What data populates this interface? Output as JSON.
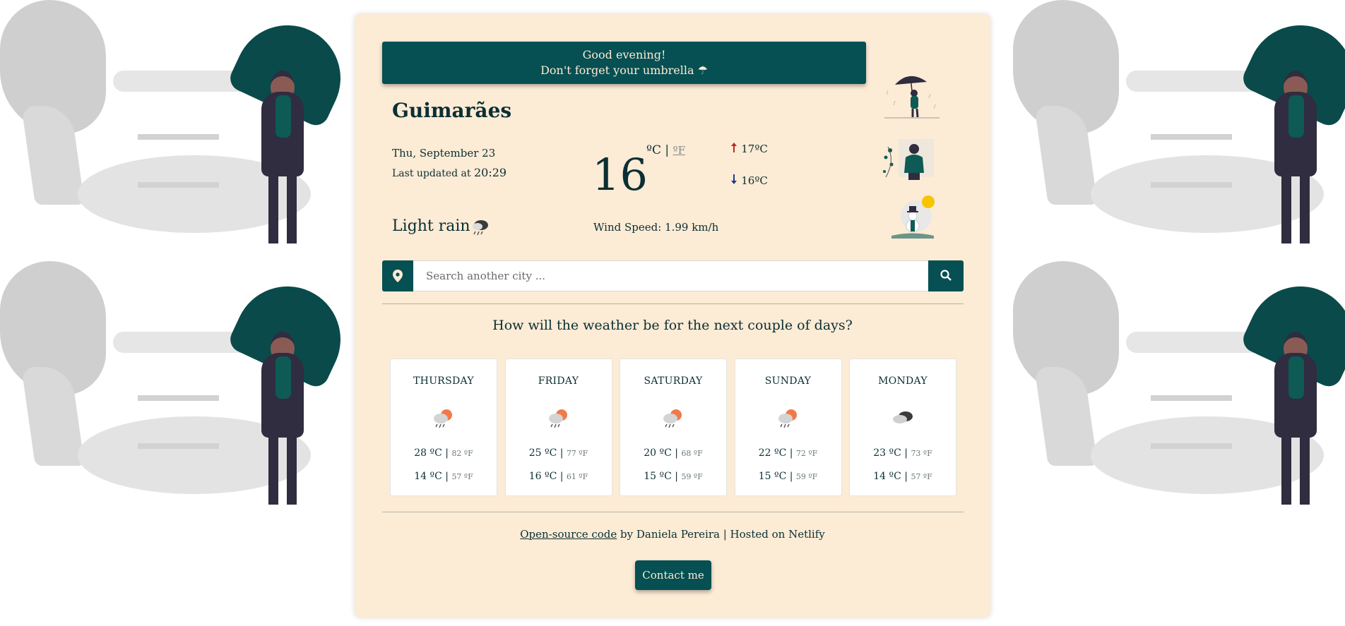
{
  "greeting": {
    "line1": "Good evening!",
    "line2": "Don't forget your umbrella ☂"
  },
  "current": {
    "city": "Guimarães",
    "date": "Thu, September 23",
    "updated_label": "Last updated at",
    "updated_time": "20:29",
    "temperature": "16",
    "unit_c": "ºC",
    "unit_sep": "|",
    "unit_f": "ºF",
    "max_arrow": "🠕",
    "max": "17ºC",
    "min_arrow": "🠗",
    "min": "16ºC",
    "description": "Light rain",
    "description_icon": "light-rain-icon",
    "wind": "Wind Speed: 1.99 km/h"
  },
  "illustrations": [
    "umbrella-person-icon",
    "autumn-person-icon",
    "snowman-icon"
  ],
  "search": {
    "placeholder": "Search another city ...",
    "pin_icon": "map-pin-icon",
    "button_icon": "search-icon"
  },
  "forecast": {
    "title": "How will the weather be for the next couple of days?",
    "days": [
      {
        "name": "THURSDAY",
        "icon": "rain-sun-icon",
        "max_c": "28 ºC",
        "max_f": "82 ºF",
        "min_c": "14 ºC",
        "min_f": "57 ºF"
      },
      {
        "name": "FRIDAY",
        "icon": "rain-sun-icon",
        "max_c": "25 ºC",
        "max_f": "77 ºF",
        "min_c": "16 ºC",
        "min_f": "61 ºF"
      },
      {
        "name": "SATURDAY",
        "icon": "rain-sun-icon",
        "max_c": "20 ºC",
        "max_f": "68 ºF",
        "min_c": "15 ºC",
        "min_f": "59 ºF"
      },
      {
        "name": "SUNDAY",
        "icon": "rain-sun-icon",
        "max_c": "22 ºC",
        "max_f": "72 ºF",
        "min_c": "15 ºC",
        "min_f": "59 ºF"
      },
      {
        "name": "MONDAY",
        "icon": "clouds-icon",
        "max_c": "23 ºC",
        "max_f": "73 ºF",
        "min_c": "14 ºC",
        "min_f": "57 ºF"
      }
    ]
  },
  "footer": {
    "link_text": "Open-source code",
    "rest_text": " by Daniela Pereira | Hosted on Netlify",
    "contact_label": "Contact me"
  },
  "colors": {
    "accent": "#064f52",
    "card_bg": "#fcebd5",
    "text": "#0b2f33"
  }
}
